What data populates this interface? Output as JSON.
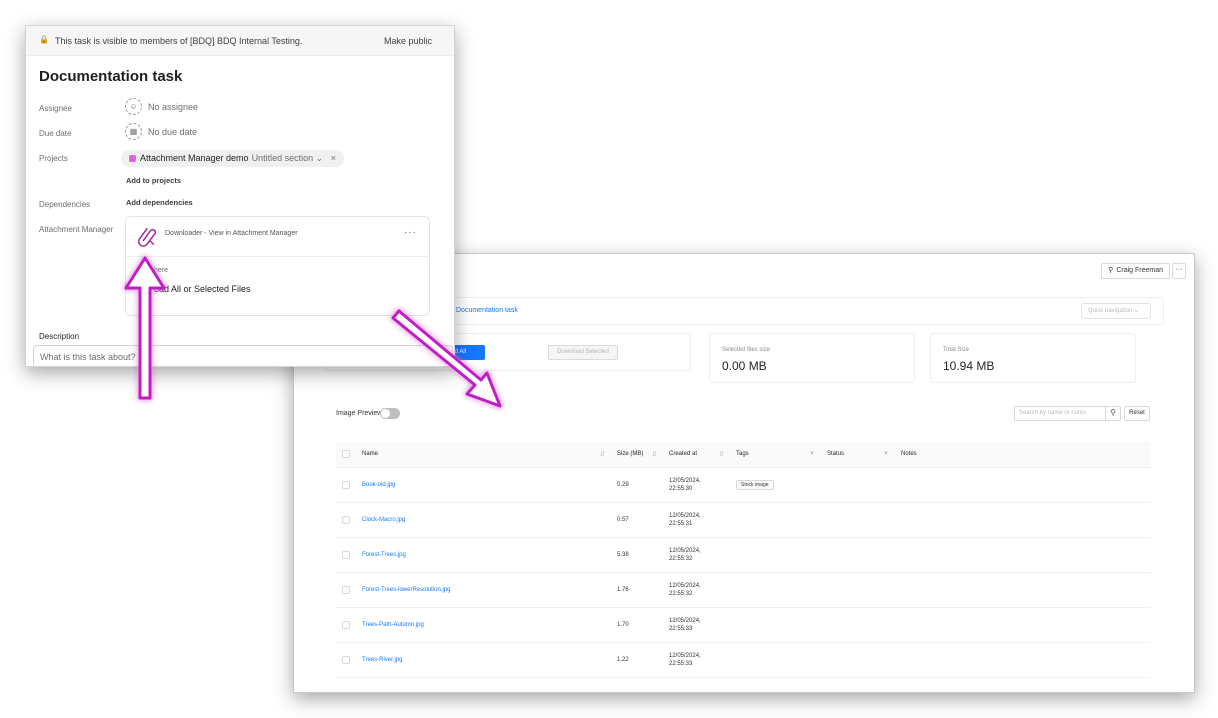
{
  "task_panel": {
    "visibility_text": "This task is visible to members of [BDQ] BDQ Internal Testing.",
    "make_public": "Make public",
    "title": "Documentation task",
    "fields": {
      "assignee_label": "Assignee",
      "assignee_value": "No assignee",
      "due_label": "Due date",
      "due_value": "No due date",
      "projects_label": "Projects",
      "project_name": "Attachment Manager demo",
      "project_section": "Untitled section",
      "add_projects": "Add to projects",
      "dependencies_label": "Dependencies",
      "add_dependencies": "Add dependencies",
      "am_label": "Attachment Manager"
    },
    "am_card": {
      "title": "Downloader - View in Attachment Manager",
      "more": "···",
      "here_text": "here",
      "download_text": "oad All or Selected Files"
    },
    "description_label": "Description",
    "description_placeholder": "What is this task about?"
  },
  "attachment_manager": {
    "user_name": "Craig Freeman",
    "more": "···",
    "breadcrumb": "Documentation task",
    "quick_navigation": "Quick navigation",
    "download_all": "oad All",
    "download_selected": "Download Selected",
    "stats": [
      {
        "label": "Selected files size",
        "value": "0.00 MB"
      },
      {
        "label": "Total Size",
        "value": "10.94 MB"
      }
    ],
    "image_preview_label": "Image Preview",
    "image_preview_on": false,
    "search_placeholder": "Search by name or notes",
    "reset": "Reset",
    "columns": [
      "Name",
      "Size (MB)",
      "Created at",
      "Tags",
      "Status",
      "Notes"
    ],
    "rows": [
      {
        "name": "Book-old.jpg",
        "size": "0.29",
        "date": "12/05/2024,",
        "time": "22:55:30",
        "tag": "Stock image"
      },
      {
        "name": "Clock-Macro.jpg",
        "size": "0.57",
        "date": "12/05/2024,",
        "time": "22:55:31",
        "tag": ""
      },
      {
        "name": "Forest-Trees.jpg",
        "size": "5.38",
        "date": "12/05/2024,",
        "time": "22:55:32",
        "tag": ""
      },
      {
        "name": "Forest-Trees-lowerResolution.jpg",
        "size": "1.76",
        "date": "12/05/2024,",
        "time": "22:55:32",
        "tag": ""
      },
      {
        "name": "Trees-Path-Autumn.jpg",
        "size": "1.70",
        "date": "12/05/2024,",
        "time": "22:55:33",
        "tag": ""
      },
      {
        "name": "Trees-River.jpg",
        "size": "1.22",
        "date": "12/05/2024,",
        "time": "22:55:33",
        "tag": ""
      }
    ]
  },
  "colors": {
    "arrow": "#c21bc4",
    "accent_blue": "#1677ff",
    "project_pink": "#e362e3"
  }
}
